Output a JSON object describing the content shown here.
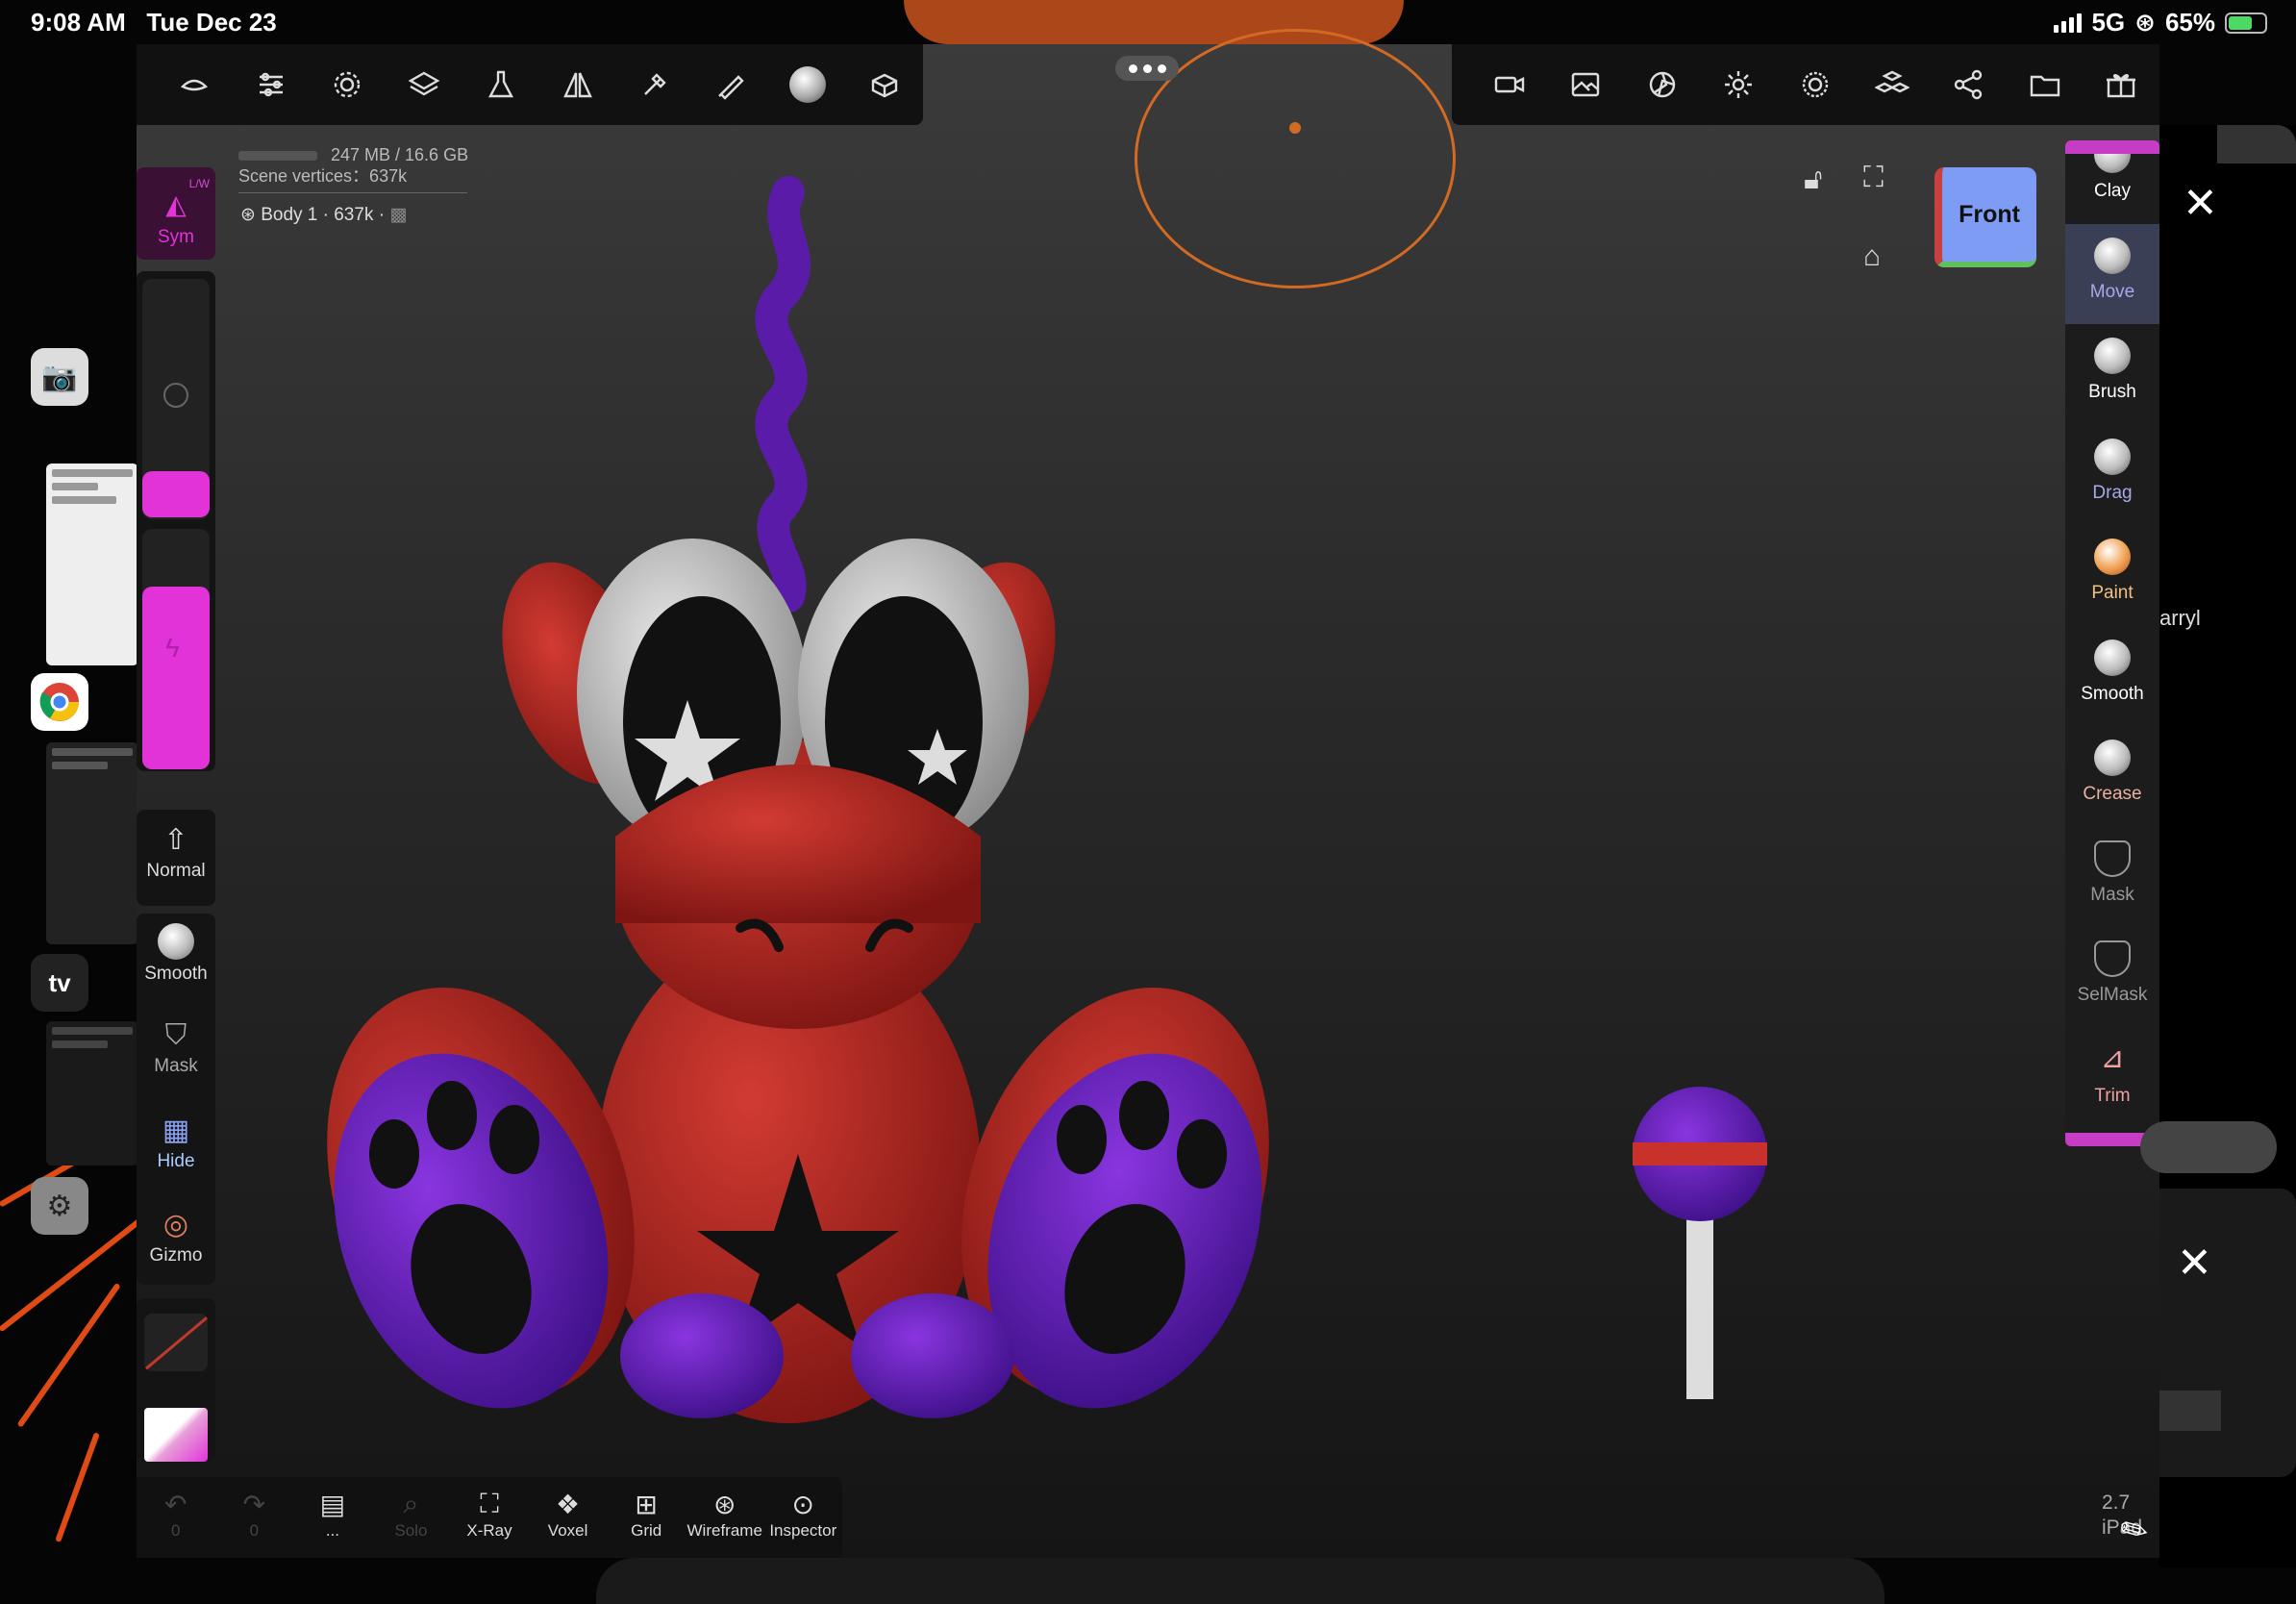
{
  "status_bar": {
    "time": "9:08 AM",
    "date": "Tue Dec 23",
    "network": "5G",
    "battery": "65%"
  },
  "scene": {
    "memory": "247 MB / 16.6 GB",
    "vertices": "Scene vertices：637k",
    "body": "Body 1 · 637k ·"
  },
  "left_panel": {
    "sym_label": "Sym",
    "sym_badge": "L/W",
    "normal_label": "Normal",
    "tools": [
      {
        "label": "Smooth",
        "icon": "smooth-icon"
      },
      {
        "label": "Mask",
        "icon": "mask-icon"
      },
      {
        "label": "Hide",
        "icon": "hide-icon"
      },
      {
        "label": "Gizmo",
        "icon": "gizmo-icon"
      }
    ],
    "accent_color": "#e233d8"
  },
  "view": {
    "cube_label": "Front"
  },
  "brushes": [
    {
      "label": "Clay",
      "color": "#ffffff"
    },
    {
      "label": "Move",
      "color": "#a8a8e8"
    },
    {
      "label": "Brush",
      "color": "#ffffff"
    },
    {
      "label": "Drag",
      "color": "#a8a8e8"
    },
    {
      "label": "Paint",
      "color": "#f0c080"
    },
    {
      "label": "Smooth",
      "color": "#ffffff"
    },
    {
      "label": "Crease",
      "color": "#e8b0a0"
    },
    {
      "label": "Mask",
      "color": "#999999"
    },
    {
      "label": "SelMask",
      "color": "#999999"
    },
    {
      "label": "Trim",
      "color": "#f0a0a0"
    }
  ],
  "active_brush": "Move",
  "bottom_bar": [
    {
      "label": "0",
      "icon": "undo-icon",
      "dim": true
    },
    {
      "label": "0",
      "icon": "redo-icon",
      "dim": true
    },
    {
      "label": "...",
      "icon": "history-icon",
      "dim": false
    },
    {
      "label": "Solo",
      "icon": "solo-icon",
      "dim": true
    },
    {
      "label": "X-Ray",
      "icon": "xray-icon",
      "dim": false
    },
    {
      "label": "Voxel",
      "icon": "voxel-icon",
      "dim": false
    },
    {
      "label": "Grid",
      "icon": "grid-icon",
      "dim": false
    },
    {
      "label": "Wireframe",
      "icon": "wireframe-icon",
      "dim": false
    },
    {
      "label": "Inspector",
      "icon": "inspector-icon",
      "dim": false
    }
  ],
  "version": {
    "number": "2.7",
    "device": "iPad"
  },
  "side_overlay": {
    "partial_text": "arryl"
  }
}
